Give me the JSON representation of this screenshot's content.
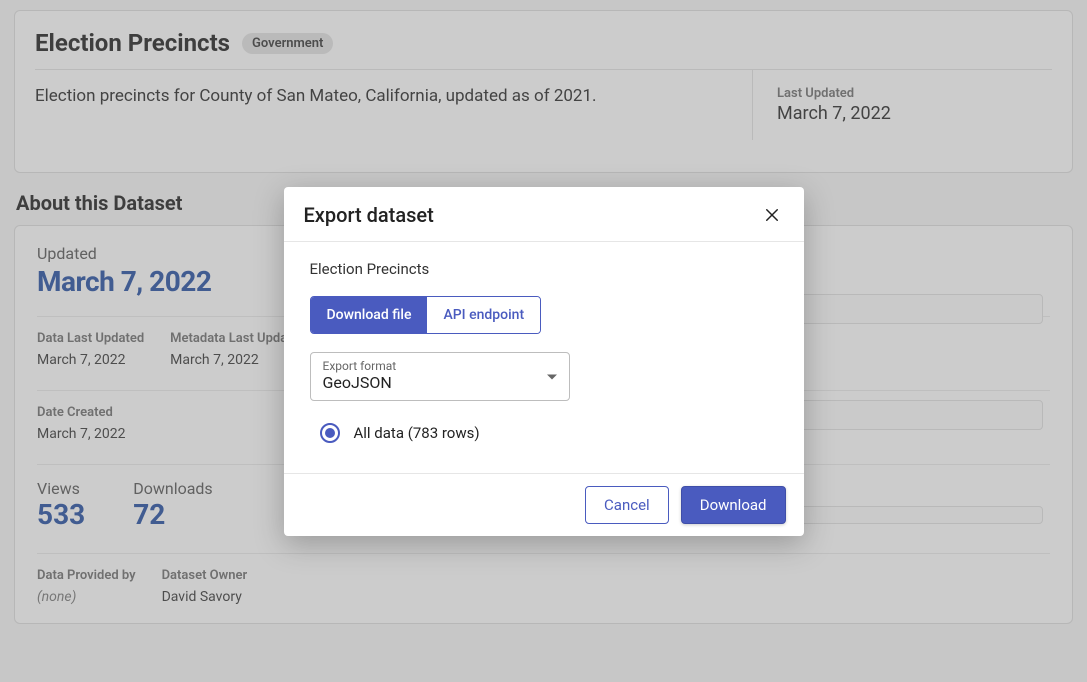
{
  "header": {
    "title": "Election Precincts",
    "badge": "Government",
    "description": "Election precincts for County of San Mateo, California, updated as of 2021.",
    "last_updated_label": "Last Updated",
    "last_updated_value": "March 7, 2022"
  },
  "about": {
    "heading": "About this Dataset",
    "updated_label": "Updated",
    "updated_value": "March 7, 2022",
    "data_last_updated_label": "Data Last Updated",
    "data_last_updated_value": "March 7, 2022",
    "metadata_last_updated_label": "Metadata Last Updated",
    "metadata_last_updated_value": "March 7, 2022",
    "date_created_label": "Date Created",
    "date_created_value": "March 7, 2022",
    "views_label": "Views",
    "views_value": "533",
    "downloads_label": "Downloads",
    "downloads_value": "72",
    "data_provided_label": "Data Provided by",
    "data_provided_value": "(none)",
    "owner_label": "Dataset Owner",
    "owner_value": "David Savory"
  },
  "modal": {
    "title": "Export dataset",
    "dataset_name": "Election Precincts",
    "tab_download": "Download file",
    "tab_api": "API endpoint",
    "format_label": "Export format",
    "format_value": "GeoJSON",
    "all_data_label": "All data (783 rows)",
    "cancel_label": "Cancel",
    "download_label": "Download"
  }
}
